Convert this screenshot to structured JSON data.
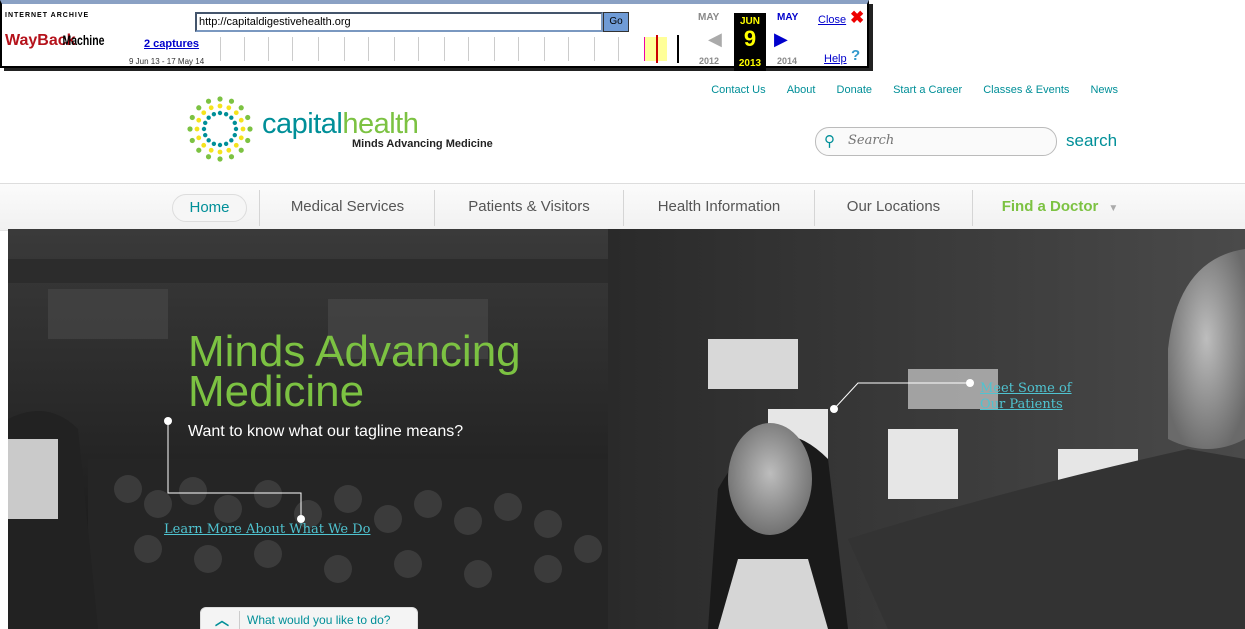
{
  "wayback": {
    "archive_label": "INTERNET ARCHIVE",
    "logo_text": "WayBackMachine",
    "url": "http://capitaldigestivehealth.org",
    "go_label": "Go",
    "captures_label": "2 captures",
    "capture_range": "9 Jun 13 - 17 May 14",
    "prev_month": "MAY",
    "prev_year": "2012",
    "current_month": "JUN",
    "current_day": "9",
    "current_year": "2013",
    "next_month": "MAY",
    "next_year": "2014",
    "close_label": "Close",
    "help_label": "Help"
  },
  "header": {
    "brand_capital": "capital",
    "brand_health": "health",
    "tagline": "Minds Advancing Medicine",
    "top_links": [
      "Contact Us",
      "About",
      "Donate",
      "Start a Career",
      "Classes & Events",
      "News"
    ],
    "search_placeholder": "Search",
    "search_label": "search"
  },
  "nav": {
    "items": [
      "Home",
      "Medical Services",
      "Patients & Visitors",
      "Health Information",
      "Our Locations",
      "Find a Doctor"
    ]
  },
  "hero": {
    "title_line1": "Minds Advancing",
    "title_line2": "Medicine",
    "subtitle": "Want to know what our tagline means?",
    "learn_more_link": "Learn More About What We Do",
    "meet_link": "Meet Some of Our Patients",
    "todo_label": "What would you like to do?"
  },
  "colors": {
    "teal": "#008f98",
    "green": "#7cc242"
  }
}
